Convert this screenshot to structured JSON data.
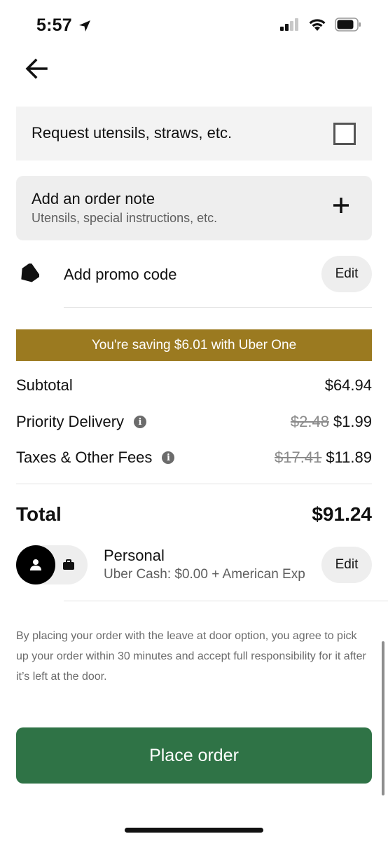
{
  "status_bar": {
    "time": "5:57",
    "icons": [
      "location-arrow-icon",
      "cellular-signal-icon",
      "wifi-icon",
      "battery-icon"
    ]
  },
  "nav": {
    "back_icon": "arrow-left-icon"
  },
  "utensils": {
    "label": "Request utensils, straws, etc.",
    "checked": false
  },
  "order_note": {
    "title": "Add an order note",
    "subtitle": "Utensils, special instructions, etc.",
    "icon": "plus-icon"
  },
  "promo": {
    "label": "Add promo code",
    "edit_label": "Edit",
    "icon": "tag-icon"
  },
  "savings_banner": {
    "text": "You're saving $6.01 with Uber One",
    "color": "#9b7a20"
  },
  "summary": {
    "subtotal_label": "Subtotal",
    "subtotal_value": "$64.94",
    "delivery_label": "Priority Delivery",
    "delivery_original": "$2.48",
    "delivery_value": "$1.99",
    "taxes_label": "Taxes & Other Fees",
    "taxes_original": "$17.41",
    "taxes_value": "$11.89",
    "total_label": "Total",
    "total_value": "$91.24"
  },
  "payment": {
    "profile": "Personal",
    "method": "Uber Cash: $0.00 + American Exp",
    "edit_label": "Edit",
    "icons": [
      "person-icon",
      "briefcase-icon"
    ]
  },
  "disclaimer": "By placing your order with the leave at door option, you agree to pick up your order within 30 minutes and accept full responsibility for it after it’s left at the door.",
  "place_order": {
    "label": "Place order",
    "color": "#2f7346"
  }
}
